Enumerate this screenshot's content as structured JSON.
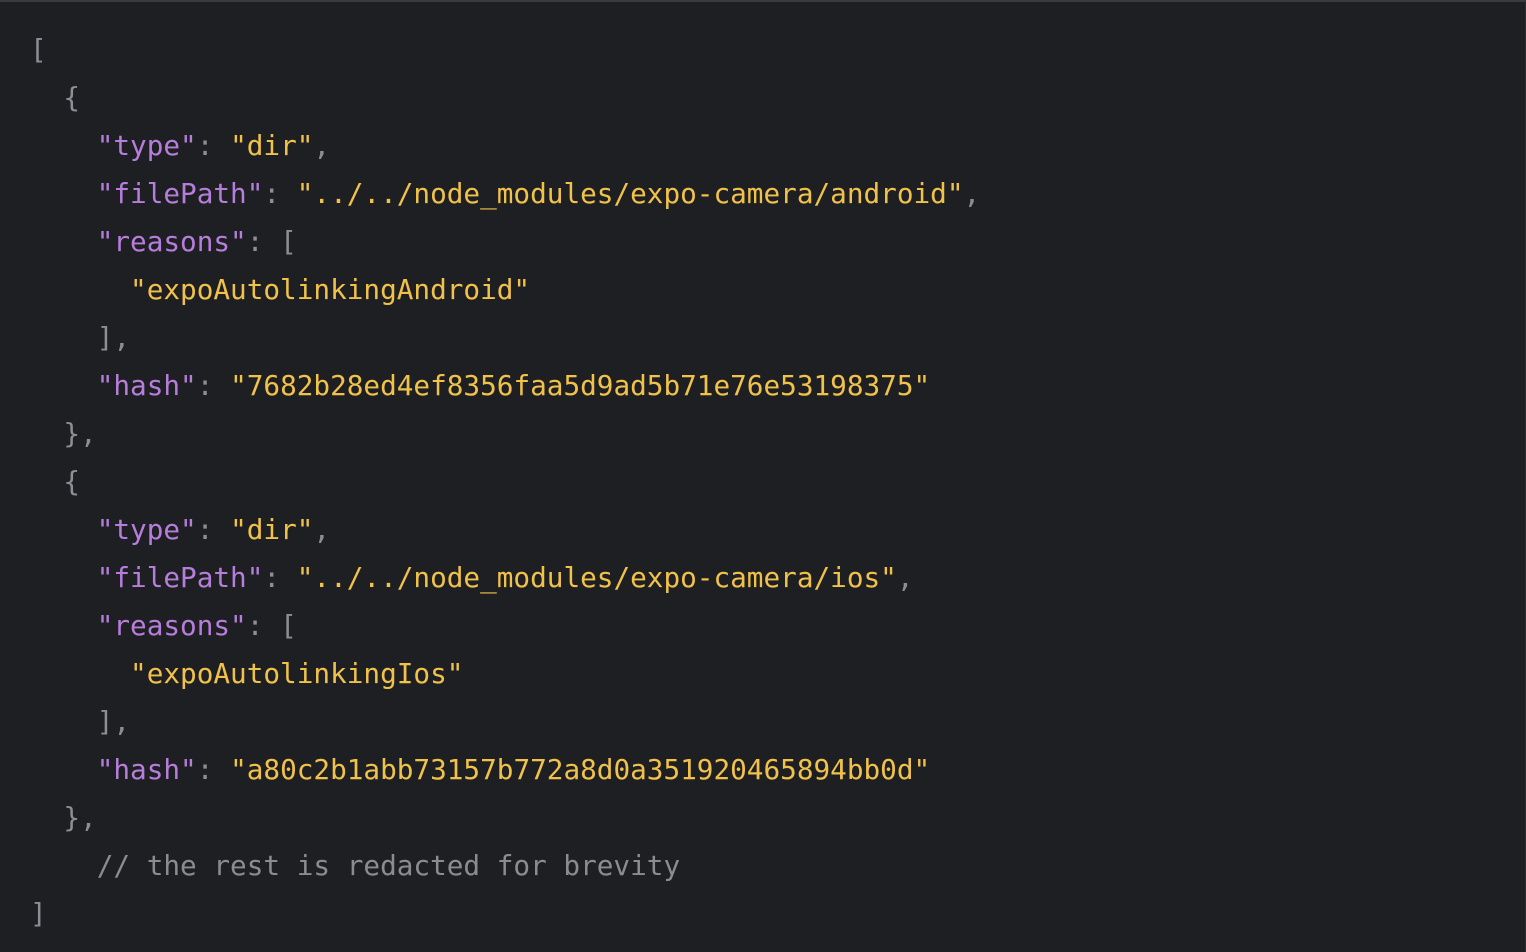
{
  "colors": {
    "background": "#1e1f22",
    "key": "#b77ddb",
    "string": "#f1c24a",
    "punctuation": "#8c8e93",
    "comment": "#8a8c90"
  },
  "code": {
    "entries": [
      {
        "type_key": "\"type\"",
        "type_value": "\"dir\"",
        "filepath_key": "\"filePath\"",
        "filepath_value": "\"../../node_modules/expo-camera/android\"",
        "reasons_key": "\"reasons\"",
        "reason": "\"expoAutolinkingAndroid\"",
        "hash_key": "\"hash\"",
        "hash_value": "\"7682b28ed4ef8356faa5d9ad5b71e76e53198375\""
      },
      {
        "type_key": "\"type\"",
        "type_value": "\"dir\"",
        "filepath_key": "\"filePath\"",
        "filepath_value": "\"../../node_modules/expo-camera/ios\"",
        "reasons_key": "\"reasons\"",
        "reason": "\"expoAutolinkingIos\"",
        "hash_key": "\"hash\"",
        "hash_value": "\"a80c2b1abb73157b772a8d0a351920465894bb0d\""
      }
    ],
    "comment": "// the rest is redacted for brevity",
    "open_array": "[",
    "close_array": "]",
    "open_object": "{",
    "close_object": "},",
    "colon": ": ",
    "comma": ",",
    "open_bracket": "[",
    "close_bracket": "],"
  }
}
